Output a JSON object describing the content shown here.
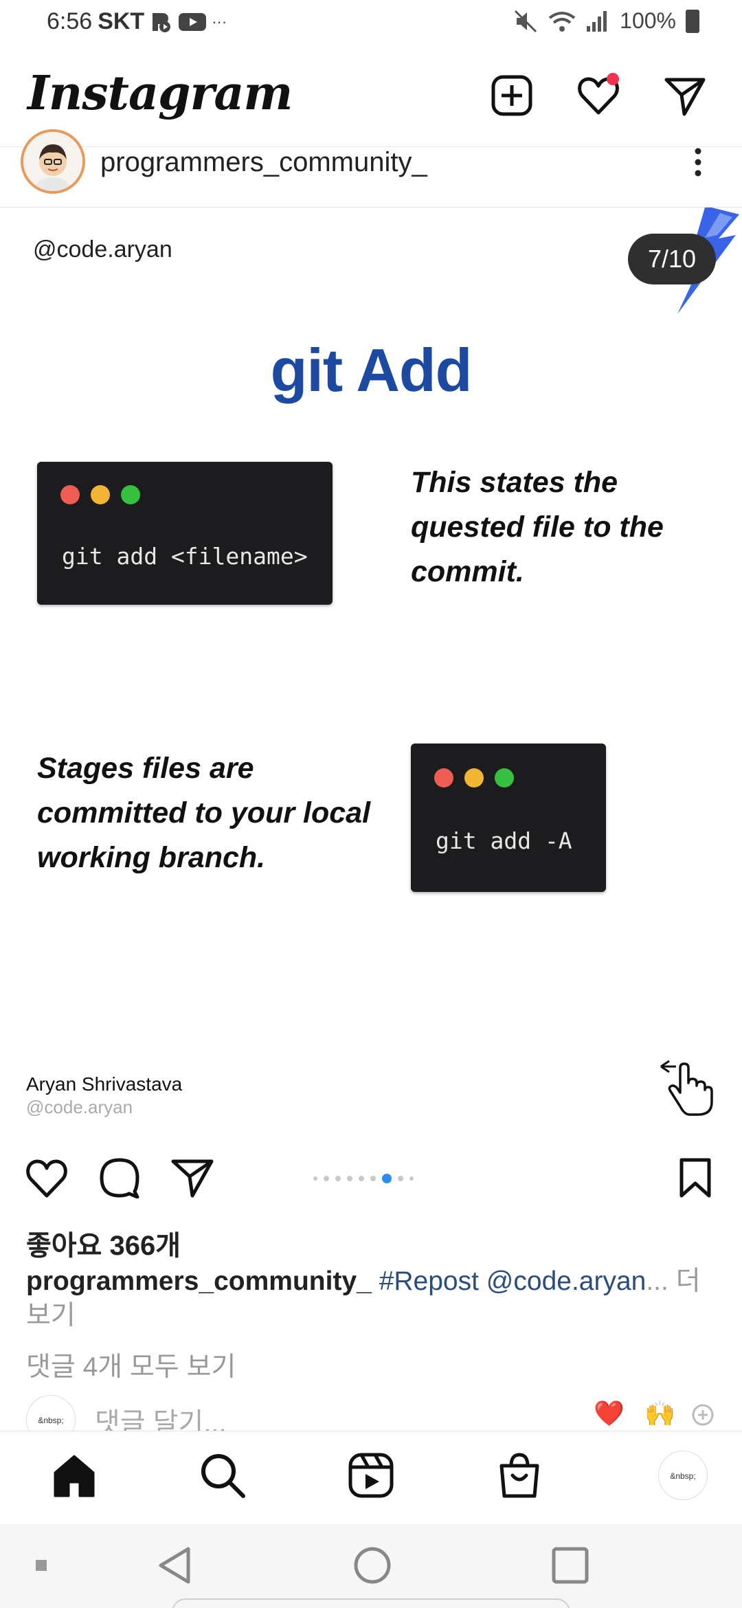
{
  "status_bar": {
    "time": "6:56",
    "carrier": "SKT",
    "more": "···",
    "battery": "100%"
  },
  "header": {
    "logo": "Instagram",
    "notification_color": "#f0344f"
  },
  "post": {
    "username": "programmers_community_",
    "slide": {
      "handle": "@code.aryan",
      "counter": "7/10",
      "title": "git Add",
      "terminal_1_command": "git add <filename>",
      "description_1": "This states the quested file to the commit.",
      "description_2": "Stages files are committed to your local working branch.",
      "terminal_2_command": "git add -A",
      "author_name": "Aryan Shrivastava",
      "author_handle": "@code.aryan",
      "title_color": "#1b4aa0"
    },
    "pager": {
      "total": 9,
      "active_index": 6
    },
    "likes": "좋아요 366개",
    "caption": {
      "user": "programmers_community_",
      "text": "#Repost @code.aryan",
      "ellipsis": "...",
      "more": "더 보기"
    },
    "view_comments": "댓글 4개 모두 보기",
    "comment": {
      "avatar_text": "&nbsp;",
      "placeholder": "댓글 달기...",
      "emoji_1": "❤️",
      "emoji_2": "🙌"
    }
  },
  "bottom_nav": {
    "profile_avatar_text": "&nbsp;"
  }
}
